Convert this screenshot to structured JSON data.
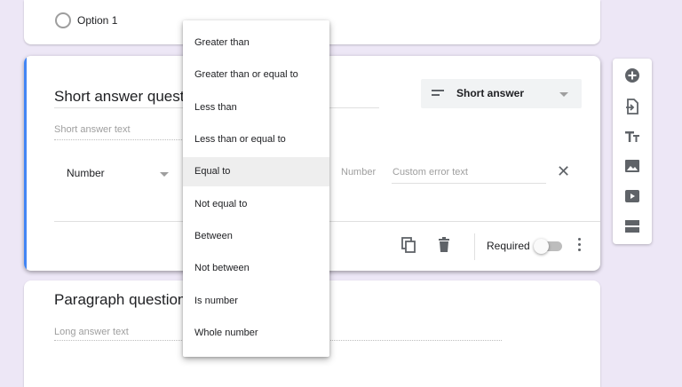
{
  "top_card": {
    "option_label": "Option 1"
  },
  "question": {
    "title": "Short answer question",
    "type_label": "Short answer",
    "answer_placeholder": "Short answer text",
    "validation_type": "Number",
    "number_placeholder": "Number",
    "error_placeholder": "Custom error text",
    "required_label": "Required",
    "required_on": false
  },
  "paragraph": {
    "title": "Paragraph question",
    "answer_placeholder": "Long answer text"
  },
  "dropdown": {
    "items": [
      "Greater than",
      "Greater than or equal to",
      "Less than",
      "Less than or equal to",
      "Equal to",
      "Not equal to",
      "Between",
      "Not between",
      "Is number",
      "Whole number"
    ],
    "selected": "Equal to"
  },
  "toolbar": {
    "icons": [
      "add-question-icon",
      "import-questions-icon",
      "add-title-icon",
      "add-image-icon",
      "add-video-icon",
      "add-section-icon"
    ]
  },
  "colors": {
    "accent": "#4285f4",
    "background": "#ede7f6"
  }
}
